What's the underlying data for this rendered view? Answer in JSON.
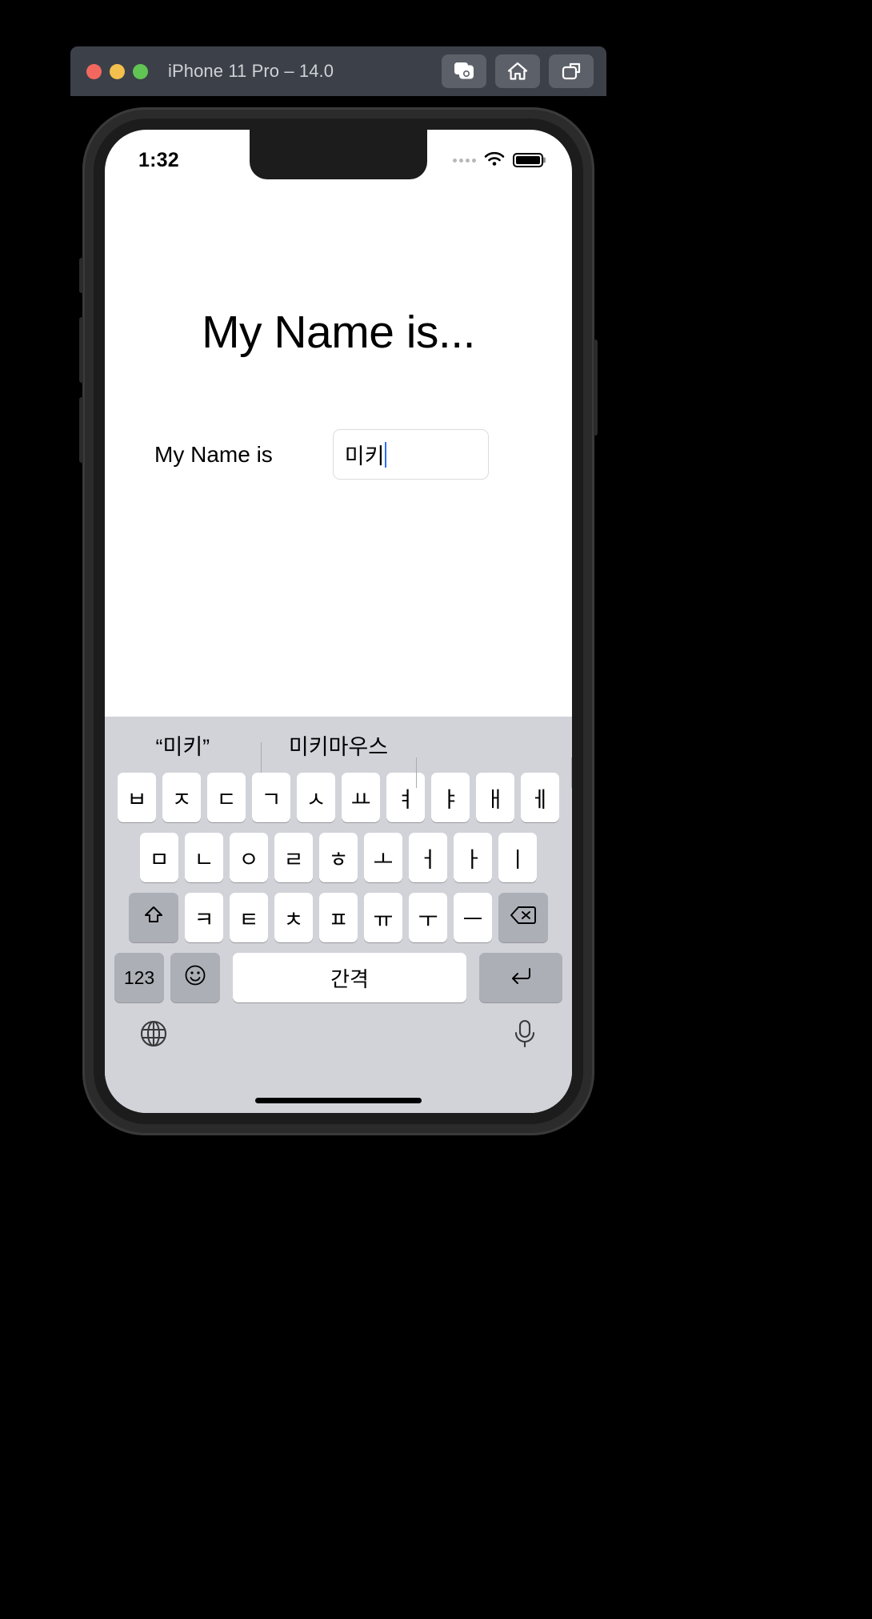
{
  "window": {
    "title": "iPhone 11 Pro – 14.0",
    "traffic_lights": [
      {
        "name": "close",
        "color": "#f2685f"
      },
      {
        "name": "minimize",
        "color": "#f3c04e"
      },
      {
        "name": "maximize",
        "color": "#61c554"
      }
    ],
    "toolbar": [
      {
        "name": "screenshot-button",
        "icon": "camera-icon"
      },
      {
        "name": "home-button",
        "icon": "home-icon"
      },
      {
        "name": "rotate-button",
        "icon": "rotate-icon"
      }
    ]
  },
  "status_bar": {
    "time": "1:32",
    "signal_icon": "signal-dots-icon",
    "wifi_icon": "wifi-icon",
    "battery_icon": "battery-full-icon"
  },
  "app": {
    "heading": "My Name is...",
    "form": {
      "label": "My Name is",
      "field_value": "미키",
      "field_placeholder": ""
    }
  },
  "keyboard": {
    "suggestions": [
      "“미키”",
      "미키마우스",
      ""
    ],
    "row1": [
      "ㅂ",
      "ㅈ",
      "ㄷ",
      "ㄱ",
      "ㅅ",
      "ㅛ",
      "ㅕ",
      "ㅑ",
      "ㅐ",
      "ㅔ"
    ],
    "row2": [
      "ㅁ",
      "ㄴ",
      "ㅇ",
      "ㄹ",
      "ㅎ",
      "ㅗ",
      "ㅓ",
      "ㅏ",
      "ㅣ"
    ],
    "row3": [
      "ㅋ",
      "ㅌ",
      "ㅊ",
      "ㅍ",
      "ㅠ",
      "ㅜ",
      "ㅡ"
    ],
    "shift_icon": "shift-arrow-icon",
    "delete_icon": "delete-backspace-icon",
    "numeric_label": "123",
    "emoji_icon": "smiley-icon",
    "space_label": "간격",
    "return_icon": "return-arrow-icon",
    "globe_icon": "globe-icon",
    "mic_icon": "microphone-icon"
  },
  "colors": {
    "titlebar": "#3c4049",
    "keyboard_bg": "#d1d3d9",
    "key_light": "#ffffff",
    "key_dark": "#acafb6",
    "caret": "#2e6ef2"
  }
}
